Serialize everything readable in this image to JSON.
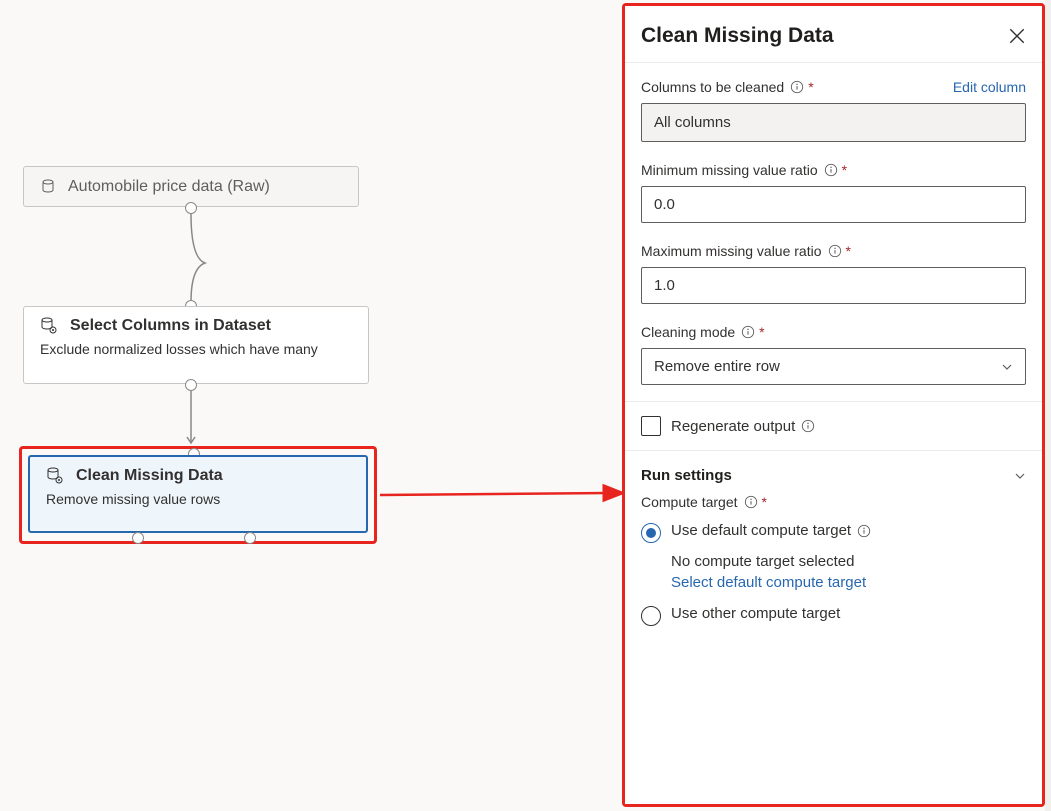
{
  "canvas": {
    "node1": {
      "label": "Automobile price data (Raw)"
    },
    "node2": {
      "title": "Select Columns in Dataset",
      "desc": "Exclude normalized losses which have many"
    },
    "node3": {
      "title": "Clean Missing Data",
      "desc": "Remove missing value rows"
    }
  },
  "panel": {
    "title": "Clean Missing Data",
    "columns": {
      "label": "Columns to be cleaned",
      "edit_link": "Edit column",
      "value": "All columns"
    },
    "min_ratio": {
      "label": "Minimum missing value ratio",
      "value": "0.0"
    },
    "max_ratio": {
      "label": "Maximum missing value ratio",
      "value": "1.0"
    },
    "mode": {
      "label": "Cleaning mode",
      "value": "Remove entire row"
    },
    "regen": {
      "label": "Regenerate output"
    },
    "run": {
      "title": "Run settings",
      "target_label": "Compute target",
      "opt_default": "Use default compute target",
      "no_target": "No compute target selected",
      "select_link": "Select default compute target",
      "opt_other": "Use other compute target"
    }
  }
}
